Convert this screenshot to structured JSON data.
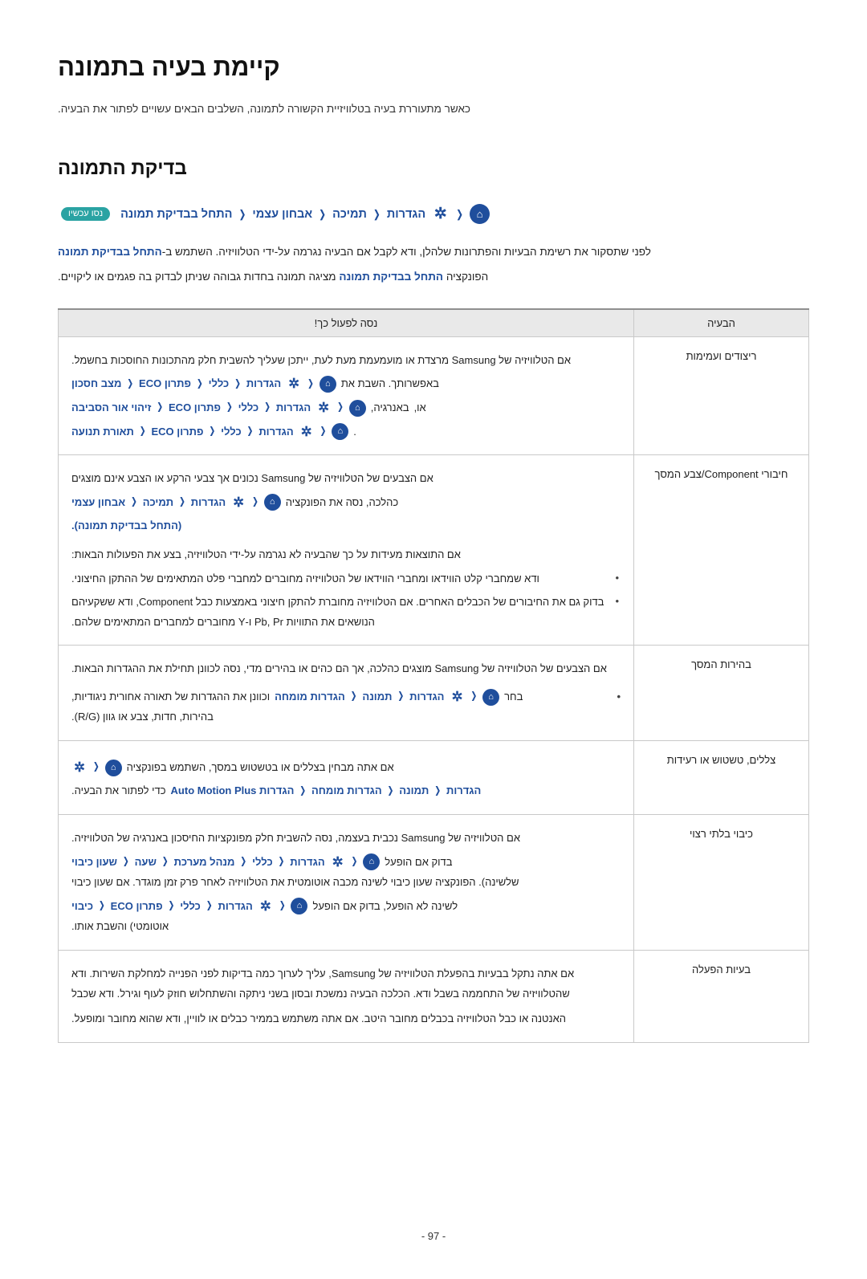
{
  "header": {
    "title": "קיימת בעיה בתמונה",
    "subtitle": "כאשר מתעוררת בעיה בטלוויזיית הקשורה לתמונה, השלבים הבאים עשויים לפתור את הבעיה."
  },
  "section": {
    "title": "בדיקת התמונה"
  },
  "path": {
    "home_icon": "⌂",
    "gear_icon": "✲",
    "items": [
      "הגדרות",
      "תמיכה",
      "אבחון עצמי",
      "התחל בבדיקת תמונה"
    ],
    "try_it": "נסו עכשיו",
    "separator": "❬"
  },
  "paragraphs": [
    {
      "before": "לפני שתסקור את רשימת הבעיות והפתרונות שלהלן, ודא לקבל אם הבעיה נגרמה על-ידי הטלוויזיה. השתמש ב-",
      "link": "התחל בבדיקת תמונה",
      "after": ""
    },
    {
      "before": "הפונקציה ",
      "link": "התחל בבדיקת תמונה",
      "after": " מציגה תמונה בחדות גבוהה שניתן לבדוק בה פגמים או ליקויים."
    }
  ],
  "table": {
    "headers": {
      "issue": "הבעיה",
      "solution": "נסה לפעול כך!"
    },
    "rows": [
      {
        "issue": "ריצודים ועמימות",
        "solution_paragraphs": [
          "אם הטלוויזיה של Samsung מרצדת או מועמעמת מעת לעת, ייתכן שעליך להשבית חלק מהתכונות החוסכות בחשמל."
        ],
        "paths": [
          {
            "lead": "באפשרותך. השבת את",
            "prefix_blue": "מצב חסכון באנרגיה",
            "items": [
              "הגדרות",
              "כללי",
              "פתרון ECO",
              "מצב חסכון"
            ]
          },
          {
            "lead": "באנרגיה, ",
            "prefix_blue": "זיהוי אור הסביבה",
            "items": [
              "הגדרות",
              "כללי",
              "פתרון ECO",
              "זיהוי אור הסביבה"
            ],
            "tail": "או,"
          },
          {
            "lead": "",
            "prefix_blue": "תאורת תנועה",
            "items": [
              "הגדרות",
              "כללי",
              "פתרון ECO",
              "תאורת תנועה"
            ],
            "tail": "."
          }
        ]
      },
      {
        "issue": "חיבורי Component/צבע המסך",
        "solution_paragraphs": [
          "אם הצבעים של הטלוויזיה של Samsung נכונים אך צבעי הרקע או הצבע אינם מוצגים",
          "כהלכה, נסה את הפונקציה התחל בבדיקת תמונה"
        ],
        "paths": [
          {
            "lead": "כהלכה, נסה את הפונקציה",
            "prefix_blue": "התחל בבדיקת תמונה",
            "items": [
              "הגדרות",
              "תמיכה",
              "אבחון עצמי"
            ],
            "tail": "(התחל בבדיקת תמונה)."
          }
        ],
        "extra_paragraph": "אם התוצאות מעידות על כך שהבעיה לא נגרמה על-ידי הטלוויזיה, בצע את הפעולות הבאות:",
        "bullets": [
          "ודא שמחברי קלט הווידאו ומחברי הווידאו של הטלוויזיה מחוברים למחברי פלט המתאימים של ההתקן החיצוני.",
          "בדוק גם את החיבורים של הכבלים האחרים. אם הטלוויזיה מחוברת להתקן חיצוני באמצעות כבל Component, ודא ששקעיהם הנושאים את התוויות Pb, Pr ו-Y מחוברים למחברים המתאימים שלהם."
        ]
      },
      {
        "issue": "בהירות המסך",
        "solution_paragraphs": [
          "אם הצבעים של הטלוויזיה של Samsung מוצגים כהלכה, אך הם כהים או בהירים מדי, נסה לכוונן תחילת את ההגדרות הבאות."
        ],
        "bullets_paths": [
          {
            "lead": "בחר",
            "items": [
              "הגדרות",
              "תמונה",
              "הגדרות מומחה"
            ],
            "tail": "וכוונן את ההגדרות של תאורה אחורית ניגודיות,",
            "tail2": "בהירות, חדות, צבע או גוון (R/G)."
          }
        ]
      },
      {
        "issue": "צללים, טשטוש או רעידות",
        "solution_paragraphs": [
          "אם אתה מבחין בצללים או בטשטוש במסך, בפונקציה השתמש"
        ],
        "paths": [
          {
            "lead": "אם אתה מבחין בצללים או בטשטוש במסך, השתמש בפונקציה",
            "prefix_blue": "הגדרות Auto Motion Plus",
            "items": [
              "הגדרות",
              "תמונה",
              "הגדרות מומחה",
              "הגדרות Auto Motion Plus"
            ],
            "tail": "כדי לפתור את הבעיה."
          }
        ]
      },
      {
        "issue": "כיבוי בלתי רצוי",
        "solution_paragraphs": [
          "אם הטלוויזיה של Samsung נכבית בעצמה, נסה להשבית חלק מפונקציות החיסכון באנרגיה של הטלוויזיה."
        ],
        "paths": [
          {
            "lead": "בדוק אם הופעל",
            "prefix_blue": "שעון כיבוי לשינה",
            "items": [
              "הגדרות",
              "כללי",
              "מנהל מערכת",
              "שעה",
              "שעון כיבוי"
            ]
          },
          {
            "lead": "שלשינה). הפונקציה שעון כיבוי לשינה מכבה אוטומטית את הטלוויזיה לאחר פרק זמן מוגדר. אם שעון כיבוי",
            "plain": "לשינה לא הופעל, בדוק אם הופעל",
            "prefix_blue": "כיבוי אוטומטי",
            "items": [
              "הגדרות",
              "כללי",
              "פתרון ECO",
              "כיבוי"
            ],
            "tail": "אוטומטי) והשבת אותו."
          }
        ]
      },
      {
        "issue": "בעיות הפעלה",
        "solution_paragraphs": [
          "אם אתה נתקל בבעיות בהפעלת הטלוויזיה של Samsung, עליך לערוך כמה בדיקות לפני הפנייה למחלקת השירות. ודא שהטלוויזיה של התחממה בשבל ודא. הכלכה הבעיה נמשכת ובסון בשני ניתקה והשתחלוש חוזק לעוף וגירל. ודא שכבל",
          "האנטנה או כבל הטלוויזיה בכבלים מחובר היטב. אם אתה משתמש בממיר כבלים או לוויין, ודא שהוא מחובר ומופעל."
        ]
      }
    ]
  },
  "footer": {
    "page_number": "- 97 -"
  }
}
